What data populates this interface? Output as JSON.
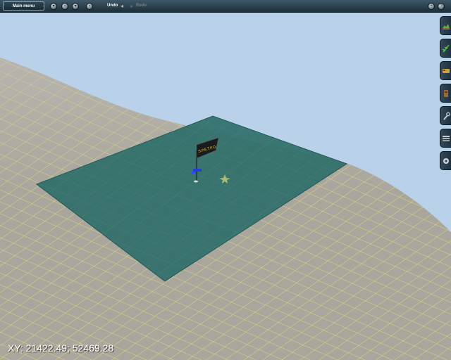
{
  "toolbar": {
    "main_menu_label": "Main menu",
    "undo_label": "Undo",
    "redo_label": "Redo",
    "left_icons": [
      "save-icon",
      "open-icon",
      "tools-icon",
      "camera-icon"
    ],
    "right_icons": [
      "zoom-in-icon",
      "help-icon"
    ]
  },
  "side_tools": [
    {
      "name": "terrain-tool-icon",
      "color": "#5fa83a"
    },
    {
      "name": "track-tool-icon",
      "color": "#4aa83a"
    },
    {
      "name": "rolling-stock-tool-icon",
      "color": "#c8a040"
    },
    {
      "name": "objects-tool-icon",
      "color": "#9a6a3a"
    },
    {
      "name": "wrench-tool-icon",
      "color": "#c0c8cc"
    },
    {
      "name": "layers-tool-icon",
      "color": "#c8ccc8"
    },
    {
      "name": "settings-tool-icon",
      "color": "#d0d4d8"
    }
  ],
  "status": {
    "xy_readout": "XY: 21422.49; 52469.28"
  },
  "colors": {
    "sky": "#b9d2ea",
    "terrain": "#a8a69c",
    "grid": "#e8e27a",
    "water": "#2f6f6b",
    "toolbar": "#2b3f4d"
  }
}
